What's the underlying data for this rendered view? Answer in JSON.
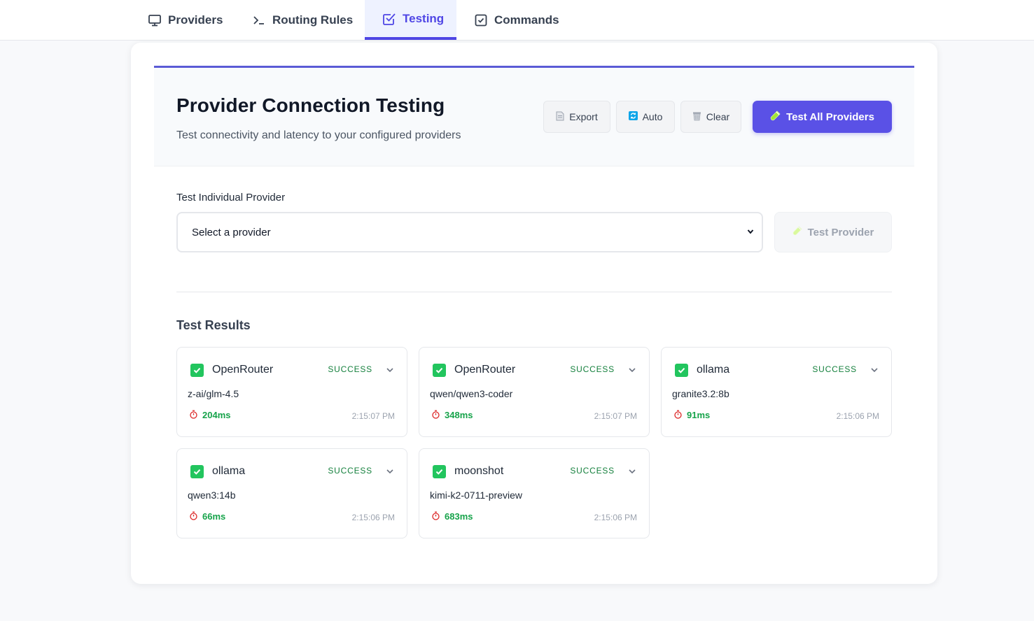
{
  "nav": {
    "tabs": [
      {
        "label": "Providers",
        "icon": "monitor-icon"
      },
      {
        "label": "Routing Rules",
        "icon": "terminal-icon"
      },
      {
        "label": "Testing",
        "icon": "checklist-icon",
        "active": true
      },
      {
        "label": "Commands",
        "icon": "check-square-icon"
      }
    ]
  },
  "header": {
    "title": "Provider Connection Testing",
    "subtitle": "Test connectivity and latency to your configured providers",
    "export_label": "Export",
    "auto_label": "Auto",
    "clear_label": "Clear",
    "test_all_label": "Test All Providers"
  },
  "individual": {
    "label": "Test Individual Provider",
    "select_value": "Select a provider",
    "test_button_label": "Test Provider"
  },
  "results": {
    "title": "Test Results",
    "items": [
      {
        "provider": "OpenRouter",
        "status": "SUCCESS",
        "model": "z-ai/glm-4.5",
        "latency": "204ms",
        "time": "2:15:07 PM"
      },
      {
        "provider": "OpenRouter",
        "status": "SUCCESS",
        "model": "qwen/qwen3-coder",
        "latency": "348ms",
        "time": "2:15:07 PM"
      },
      {
        "provider": "ollama",
        "status": "SUCCESS",
        "model": "granite3.2:8b",
        "latency": "91ms",
        "time": "2:15:06 PM"
      },
      {
        "provider": "ollama",
        "status": "SUCCESS",
        "model": "qwen3:14b",
        "latency": "66ms",
        "time": "2:15:06 PM"
      },
      {
        "provider": "moonshot",
        "status": "SUCCESS",
        "model": "kimi-k2-0711-preview",
        "latency": "683ms",
        "time": "2:15:06 PM"
      }
    ]
  },
  "colors": {
    "accent": "#4f46e5",
    "success": "#22c55e",
    "success_text": "#15803d"
  }
}
